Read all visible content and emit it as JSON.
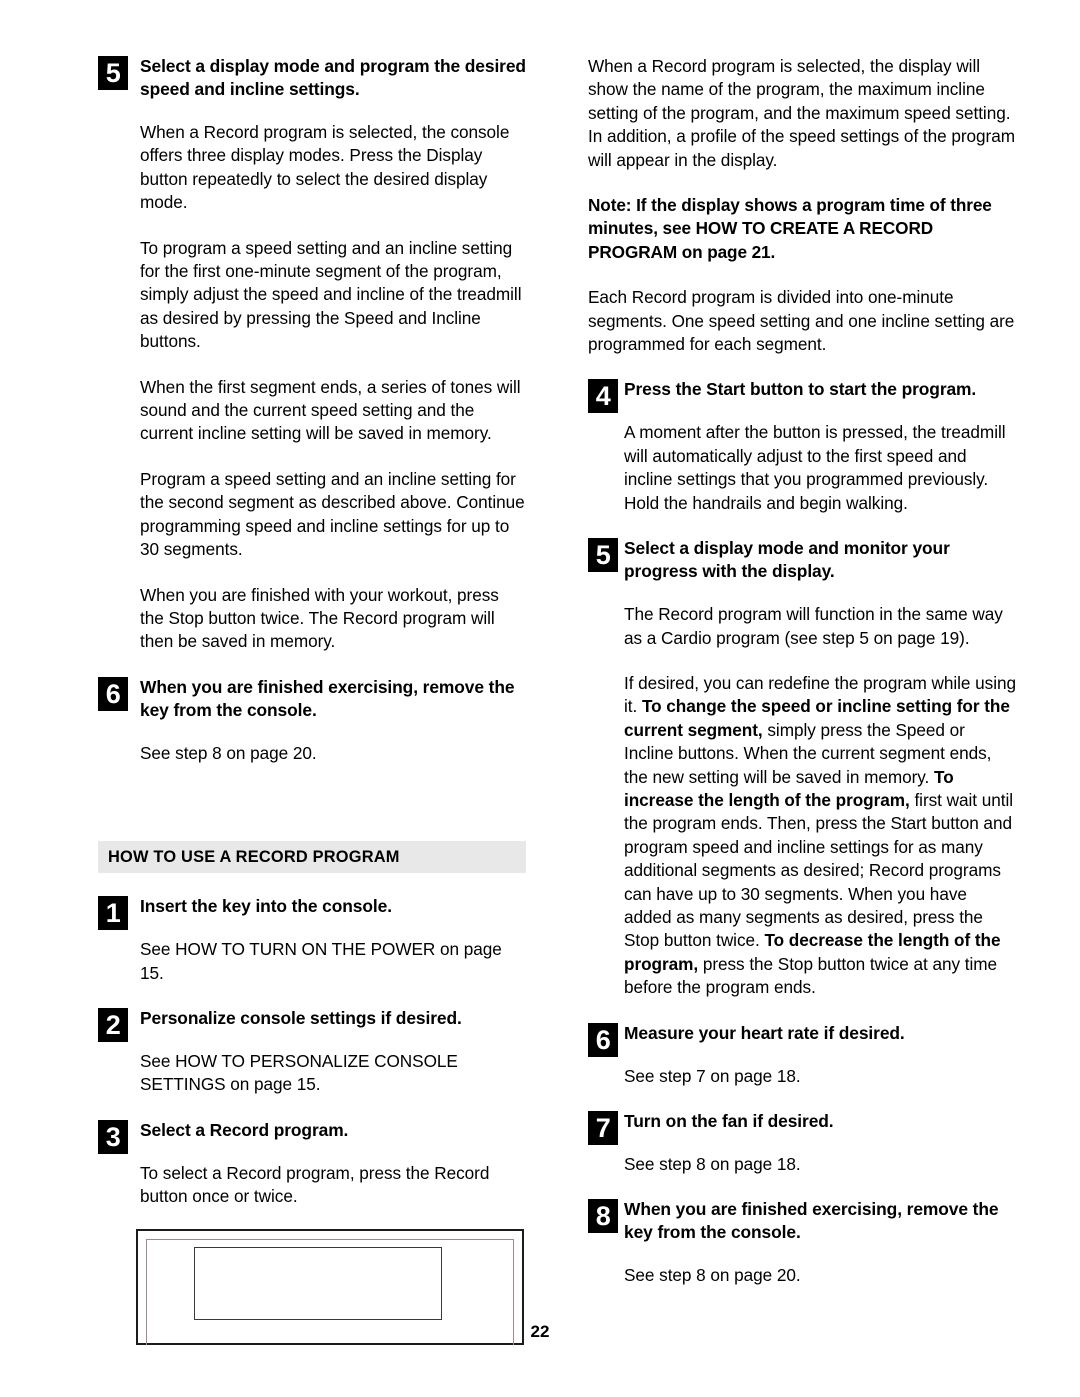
{
  "page_number": "22",
  "left_column": {
    "step5": {
      "number": "5",
      "title": "Select a display mode and program the desired speed and incline settings.",
      "paragraphs": [
        "When a Record program is selected, the console offers three display modes. Press the Display button repeatedly to select the desired display mode.",
        "To program a speed setting and an incline setting for the first one-minute segment of the program, simply adjust the speed and incline of the treadmill as desired by pressing the Speed and Incline buttons.",
        "When the first segment ends, a series of tones will sound and the current speed setting and the current incline setting will be saved in memory.",
        "Program a speed setting and an incline setting for the second segment as described above. Continue programming speed and incline settings for up to 30 segments.",
        "When you are finished with your workout, press the Stop button twice. The Record program will then be saved in memory."
      ]
    },
    "step6": {
      "number": "6",
      "title": "When you are finished exercising, remove the key from the console.",
      "paragraphs": [
        "See step 8 on page 20."
      ]
    },
    "section_header": "HOW TO USE A RECORD PROGRAM",
    "step1": {
      "number": "1",
      "title": "Insert the key into the console.",
      "paragraphs": [
        "See HOW TO TURN ON THE POWER on page 15."
      ]
    },
    "step2": {
      "number": "2",
      "title": "Personalize console settings if desired.",
      "paragraphs": [
        "See HOW TO PERSONALIZE CONSOLE SETTINGS on page 15."
      ]
    },
    "step3": {
      "number": "3",
      "title": "Select a Record program.",
      "paragraphs": [
        "To select a Record program, press the Record button once or twice."
      ]
    },
    "figure": {
      "name": "treadmill-console-illustration"
    }
  },
  "right_column": {
    "intro_paragraph": "When a Record program is selected, the display will show the name of the program, the maximum incline setting of the program, and the maximum speed setting. In addition, a profile of the speed settings of the program will appear in the display.",
    "note": "Note: If the display shows a program time of three minutes, see HOW TO CREATE A RECORD PROGRAM on page 21.",
    "segments_paragraph": "Each Record program is divided into one-minute segments. One speed setting and one incline setting are programmed for each segment.",
    "step4": {
      "number": "4",
      "title": "Press the Start button to start the program.",
      "paragraphs": [
        "A moment after the button is pressed, the treadmill will automatically adjust to the first speed and incline settings that you programmed previously. Hold the handrails and begin walking."
      ]
    },
    "step5": {
      "number": "5",
      "title": "Select a display mode and monitor your progress with the display.",
      "paragraph_1": "The Record program will function in the same way as a Cardio program (see step 5 on page 19).",
      "redefine": {
        "part1": "If desired, you can redefine the program while using it. ",
        "bold1": "To change the speed or incline setting for the current segment,",
        "part2": " simply press the Speed or Incline buttons. When the current segment ends, the new setting will be saved in memory. ",
        "bold2": "To increase the length of the program,",
        "part3": " first wait until the program ends. Then, press the Start button and program speed and incline settings for as many additional segments as desired; Record programs can have up to 30 segments. When you have added as many segments as desired, press the Stop button twice. ",
        "bold3": "To decrease the length of the program,",
        "part4": " press the Stop button twice at any time before the program ends."
      }
    },
    "step6": {
      "number": "6",
      "title": "Measure your heart rate if desired.",
      "paragraphs": [
        "See step 7 on page 18."
      ]
    },
    "step7": {
      "number": "7",
      "title": "Turn on the fan if desired.",
      "paragraphs": [
        "See step 8 on page 18."
      ]
    },
    "step8": {
      "number": "8",
      "title": "When you are finished exercising, remove the key from the console.",
      "paragraphs": [
        "See step 8 on page 20."
      ]
    }
  }
}
